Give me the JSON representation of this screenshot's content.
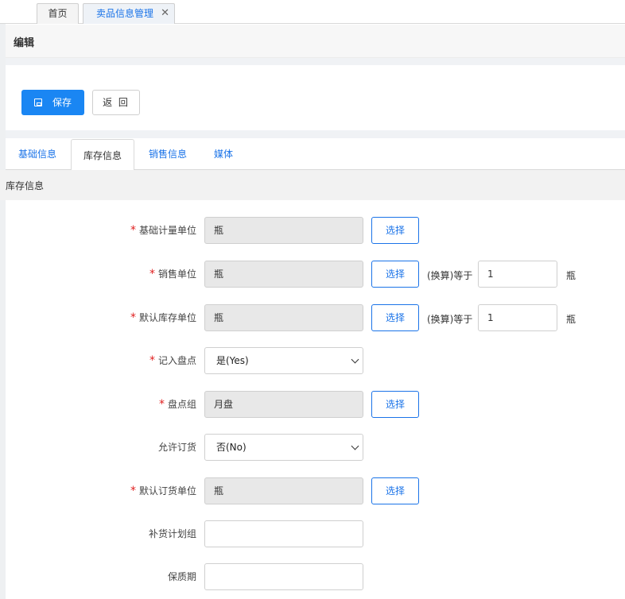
{
  "top_tabs": [
    {
      "label": "首页"
    },
    {
      "label": "卖品信息管理",
      "close": "✕"
    }
  ],
  "edit_title": "编辑",
  "toolbar": {
    "save_label": "保存",
    "back_label": "返 回"
  },
  "section_tabs": [
    {
      "label": "基础信息"
    },
    {
      "label": "库存信息",
      "active": true
    },
    {
      "label": "销售信息"
    },
    {
      "label": "媒体"
    }
  ],
  "section_title": "库存信息",
  "form": {
    "choose_label": "选择",
    "conversion_label": "(换算)等于",
    "fields": [
      {
        "label": "基础计量单位",
        "required": true,
        "value": "瓶"
      },
      {
        "label": "销售单位",
        "required": true,
        "value": "瓶",
        "conversion_value": "1",
        "conversion_unit": "瓶"
      },
      {
        "label": "默认库存单位",
        "required": true,
        "value": "瓶",
        "conversion_value": "1",
        "conversion_unit": "瓶"
      },
      {
        "label": "记入盘点",
        "required": true,
        "value": "是(Yes)"
      },
      {
        "label": "盘点组",
        "required": true,
        "value": "月盘"
      },
      {
        "label": "允许订货",
        "required": false,
        "value": "否(No)"
      },
      {
        "label": "默认订货单位",
        "required": true,
        "value": "瓶"
      },
      {
        "label": "补货计划组",
        "required": false,
        "value": ""
      },
      {
        "label": "保质期",
        "required": false,
        "value": ""
      }
    ]
  }
}
